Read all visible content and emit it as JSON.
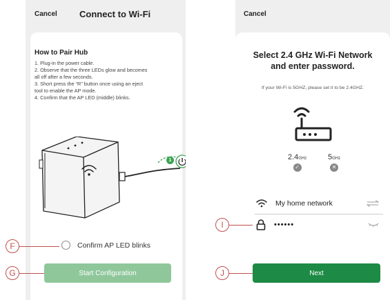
{
  "left_screen": {
    "cancel_label": "Cancel",
    "title": "Connect to Wi-Fi",
    "pair_title": "How to Pair Hub",
    "steps": [
      "1. Plug-in the power cable.",
      "2. Observe that the three LEDs glow and becomes",
      "all off after a few seconds.",
      "3. Short press the “R” button once using an eject",
      "tool to enable the AP mode.",
      "4. Confirm that the AP LED (middle) blinks."
    ],
    "illustration_step_badge": "1",
    "confirm_label": "Confirm AP LED blinks",
    "start_button": "Start Configuration"
  },
  "right_screen": {
    "cancel_label": "Cancel",
    "title_line1": "Select 2.4 GHz Wi-Fi Network",
    "title_line2": "and enter password.",
    "subtitle": "If your Wi-Fi is 5GHZ, please set it to be 2.4GHZ.",
    "freq_24": "2.4",
    "freq_5": "5",
    "freq_unit": "GHz",
    "network_name": "My home network",
    "password_mask": "••••••",
    "next_button": "Next"
  },
  "callouts": {
    "F": "F",
    "G": "G",
    "I": "I",
    "J": "J"
  },
  "colors": {
    "start_button_disabled": "#8fc79b",
    "next_button": "#1d8a45",
    "callout": "#c0504d",
    "badge_green": "#3aa350"
  }
}
